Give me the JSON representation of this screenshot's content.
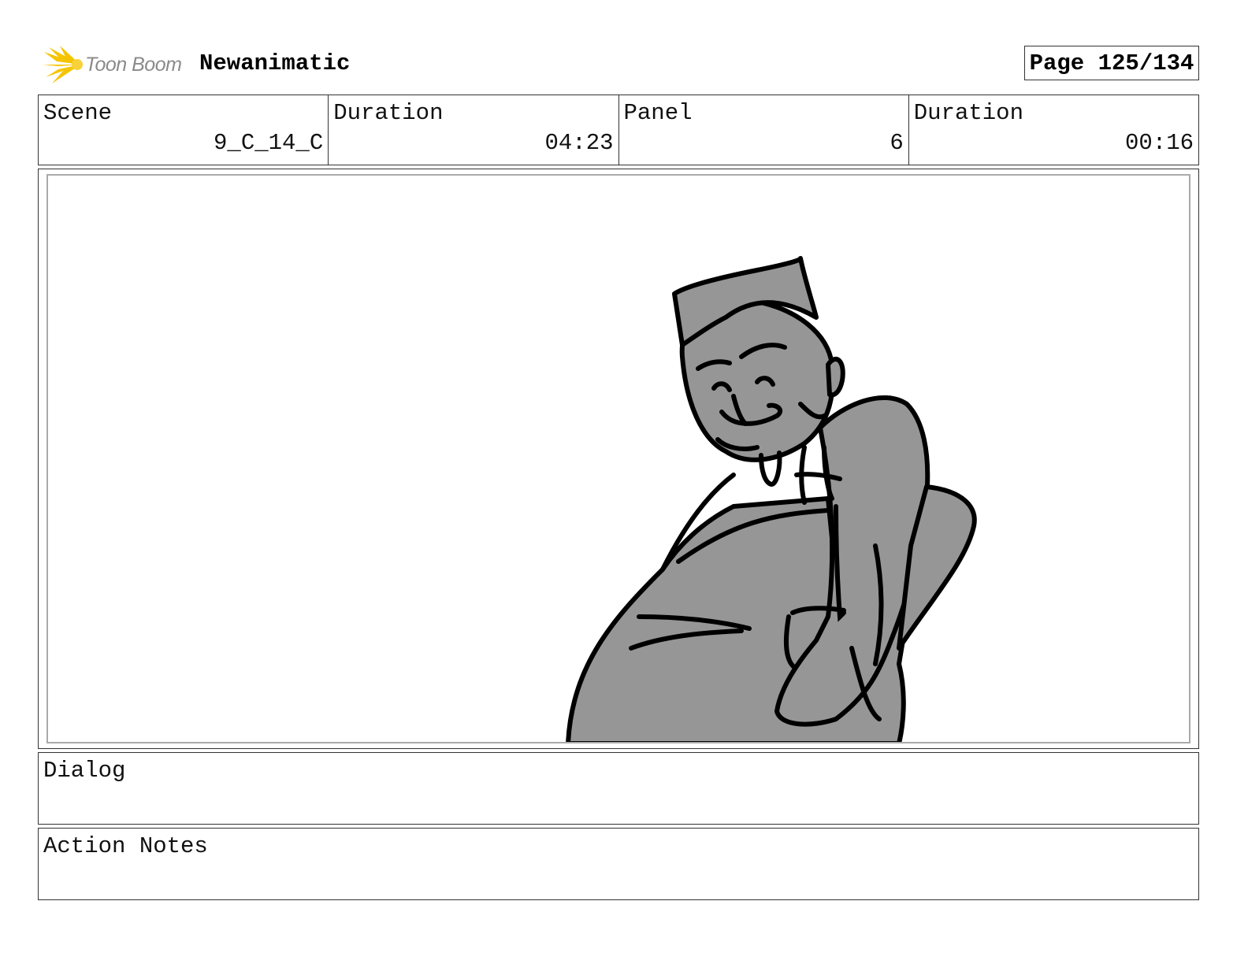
{
  "header": {
    "logo_text": "Toon Boom",
    "project_title": "Newanimatic",
    "page_label": "Page 125/134"
  },
  "info": {
    "scene_label": "Scene",
    "scene_value": "9_C_14_C",
    "scene_duration_label": "Duration",
    "scene_duration_value": "04:23",
    "panel_label": "Panel",
    "panel_value": "6",
    "panel_duration_label": "Duration",
    "panel_duration_value": "00:16"
  },
  "dialog": {
    "label": "Dialog"
  },
  "action_notes": {
    "label": "Action Notes"
  },
  "colors": {
    "logo_accent": "#f5c400",
    "sketch_fill": "#969696",
    "ink": "#000000"
  }
}
